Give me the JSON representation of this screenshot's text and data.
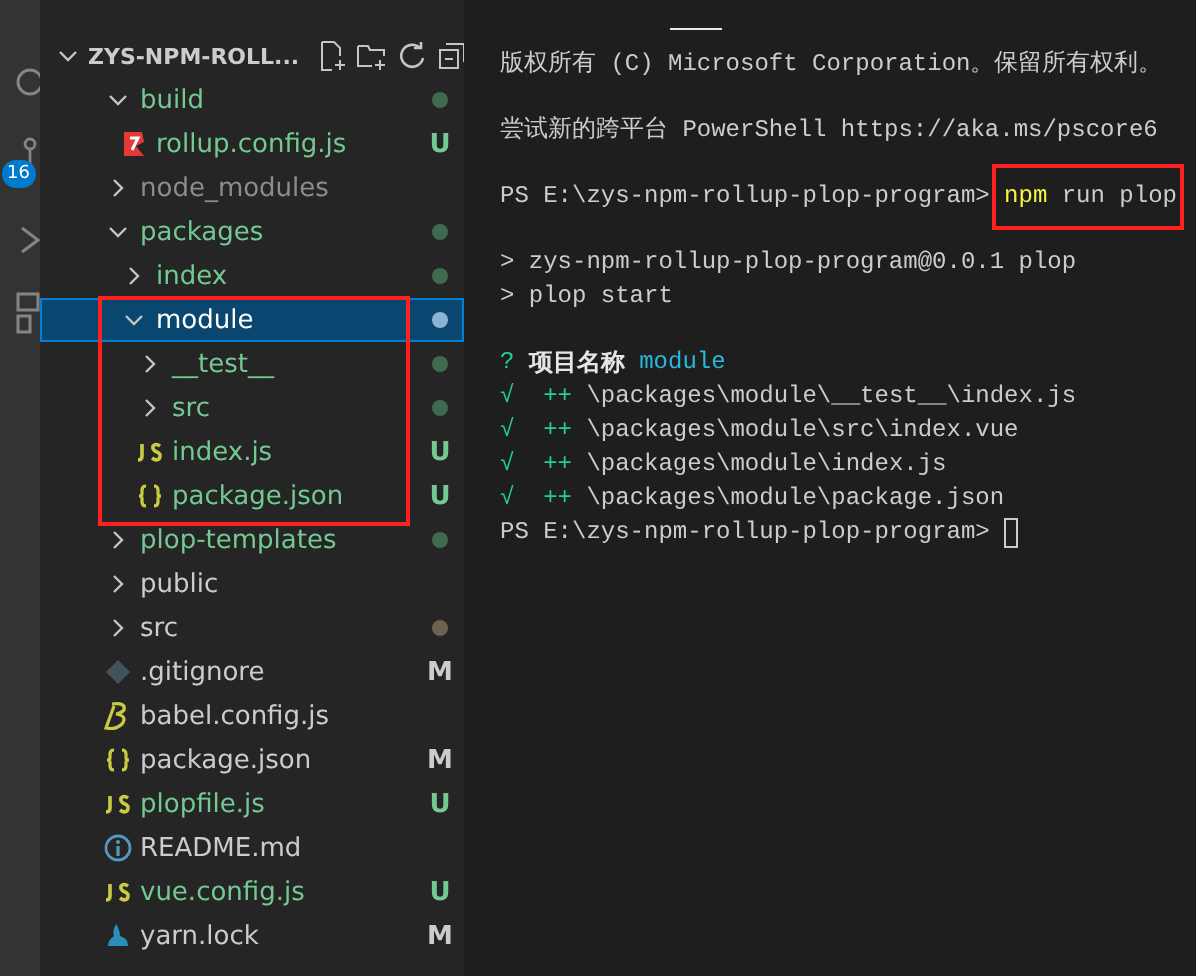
{
  "activity_bar": {
    "badge": "16"
  },
  "explorer": {
    "title": "ZYS-NPM-ROLL...",
    "expanded": true,
    "items": [
      {
        "name": "build",
        "kind": "folder",
        "expanded": true,
        "selected": false,
        "highlighted": false,
        "untracked": true,
        "ignored": false,
        "dot": true,
        "children": [
          {
            "name": "rollup.config.js",
            "kind": "rollup",
            "selected": false,
            "highlighted": false,
            "untracked": true,
            "ignored": false,
            "badge": "U"
          }
        ]
      },
      {
        "name": "node_modules",
        "kind": "folder",
        "expanded": false,
        "selected": false,
        "highlighted": false,
        "untracked": false,
        "ignored": true,
        "dot": false
      },
      {
        "name": "packages",
        "kind": "folder",
        "expanded": true,
        "selected": false,
        "highlighted": false,
        "untracked": true,
        "ignored": false,
        "dot": true,
        "children": [
          {
            "name": "index",
            "kind": "folder",
            "expanded": false,
            "selected": false,
            "highlighted": false,
            "untracked": true,
            "ignored": false,
            "dot": true
          },
          {
            "name": "module",
            "kind": "folder",
            "expanded": true,
            "selected": true,
            "highlighted": true,
            "untracked": true,
            "ignored": false,
            "dot": true,
            "children": [
              {
                "name": "__test__",
                "kind": "folder",
                "expanded": false,
                "selected": false,
                "highlighted": false,
                "untracked": true,
                "ignored": false,
                "dot": true
              },
              {
                "name": "src",
                "kind": "folder",
                "expanded": false,
                "selected": false,
                "highlighted": false,
                "untracked": true,
                "ignored": false,
                "dot": true
              },
              {
                "name": "index.js",
                "kind": "js",
                "selected": false,
                "highlighted": false,
                "untracked": true,
                "ignored": false,
                "badge": "U"
              },
              {
                "name": "package.json",
                "kind": "json",
                "selected": false,
                "highlighted": false,
                "untracked": true,
                "ignored": false,
                "badge": "U"
              }
            ]
          }
        ]
      },
      {
        "name": "plop-templates",
        "kind": "folder",
        "expanded": false,
        "selected": false,
        "highlighted": false,
        "untracked": true,
        "ignored": false,
        "dot": true
      },
      {
        "name": "public",
        "kind": "folder",
        "expanded": false,
        "selected": false,
        "highlighted": false,
        "untracked": false,
        "ignored": false,
        "dot": false
      },
      {
        "name": "src",
        "kind": "folder",
        "expanded": false,
        "selected": false,
        "highlighted": false,
        "untracked": false,
        "ignored": false,
        "dot": true
      },
      {
        "name": ".gitignore",
        "kind": "git",
        "selected": false,
        "highlighted": false,
        "untracked": false,
        "ignored": false,
        "badge": "M"
      },
      {
        "name": "babel.config.js",
        "kind": "babel",
        "selected": false,
        "highlighted": false,
        "untracked": false,
        "ignored": false
      },
      {
        "name": "package.json",
        "kind": "json",
        "selected": false,
        "highlighted": false,
        "untracked": false,
        "ignored": false,
        "badge": "M"
      },
      {
        "name": "plopfile.js",
        "kind": "js",
        "selected": false,
        "highlighted": false,
        "untracked": true,
        "ignored": false,
        "badge": "U"
      },
      {
        "name": "README.md",
        "kind": "info",
        "selected": false,
        "highlighted": false,
        "untracked": false,
        "ignored": false
      },
      {
        "name": "vue.config.js",
        "kind": "js",
        "selected": false,
        "highlighted": false,
        "untracked": true,
        "ignored": false,
        "badge": "U"
      },
      {
        "name": "yarn.lock",
        "kind": "yarn",
        "selected": false,
        "highlighted": false,
        "untracked": false,
        "ignored": false,
        "badge": "M"
      }
    ]
  },
  "terminal": {
    "blocks": [
      [
        [
          {
            "text": "版权所有 (C) Microsoft Corporation。保留所有权利。",
            "kind": "plain"
          }
        ]
      ],
      [
        [
          {
            "text": "尝试新的跨平台 PowerShell https://aka.ms/pscore6",
            "kind": "plain"
          }
        ]
      ],
      [
        [
          {
            "text": "PS E:\\zys-npm-rollup-plop-program> ",
            "kind": "plain"
          },
          {
            "kind": "highlight",
            "segments": [
              {
                "text": "npm",
                "kind": "command"
              },
              {
                "text": " run plop",
                "kind": "plain"
              }
            ]
          }
        ]
      ],
      [
        [
          {
            "text": "> zys-npm-rollup-plop-program@0.0.1 plop",
            "kind": "plain"
          }
        ],
        [
          {
            "text": "> plop start",
            "kind": "plain"
          }
        ]
      ],
      [
        [
          {
            "text": "? ",
            "kind": "green"
          },
          {
            "text": "项目名称",
            "kind": "bold"
          },
          {
            "text": " module",
            "kind": "cyan"
          }
        ],
        [
          {
            "text": "√",
            "kind": "green"
          },
          {
            "text": "  ++",
            "kind": "green"
          },
          {
            "text": " \\packages\\module\\__test__\\index.js",
            "kind": "plain"
          }
        ],
        [
          {
            "text": "√",
            "kind": "green"
          },
          {
            "text": "  ++",
            "kind": "green"
          },
          {
            "text": " \\packages\\module\\src\\index.vue",
            "kind": "plain"
          }
        ],
        [
          {
            "text": "√",
            "kind": "green"
          },
          {
            "text": "  ++",
            "kind": "green"
          },
          {
            "text": " \\packages\\module\\index.js",
            "kind": "plain"
          }
        ],
        [
          {
            "text": "√",
            "kind": "green"
          },
          {
            "text": "  ++",
            "kind": "green"
          },
          {
            "text": " \\packages\\module\\package.json",
            "kind": "plain"
          }
        ],
        [
          {
            "text": "PS E:\\zys-npm-rollup-plop-program> ",
            "kind": "plain"
          },
          {
            "kind": "cursor"
          }
        ]
      ]
    ]
  }
}
